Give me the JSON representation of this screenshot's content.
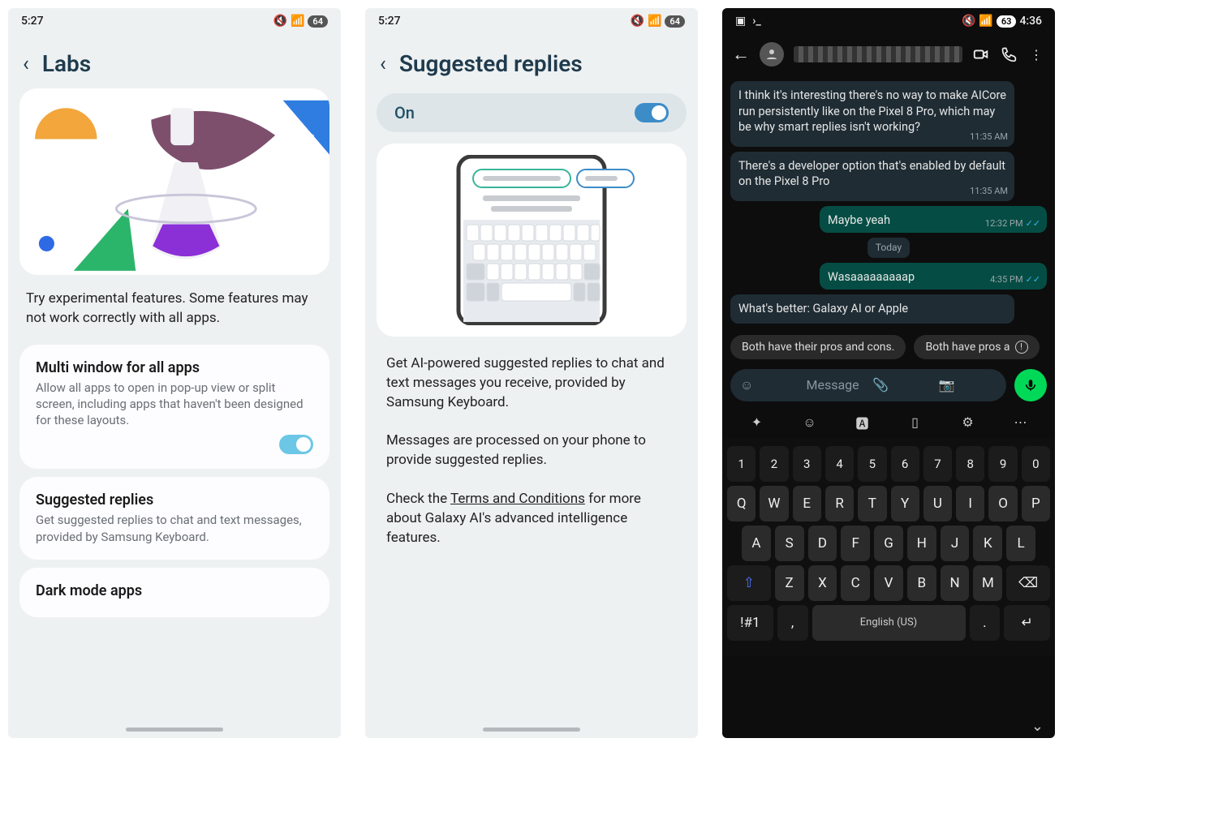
{
  "screen1": {
    "status": {
      "time": "5:27",
      "battery": "64"
    },
    "title": "Labs",
    "desc": "Try experimental features. Some features may not work correctly with all apps.",
    "items": [
      {
        "title": "Multi window for all apps",
        "sub": "Allow all apps to open in pop-up view or split screen, including apps that haven't been designed for these layouts.",
        "toggle": true
      },
      {
        "title": "Suggested replies",
        "sub": "Get suggested replies to chat and text messages, provided by Samsung Keyboard."
      },
      {
        "title": "Dark mode apps"
      }
    ]
  },
  "screen2": {
    "status": {
      "time": "5:27",
      "battery": "64"
    },
    "title": "Suggested replies",
    "on_label": "On",
    "p1": "Get AI-powered suggested replies to chat and text messages you receive, provided by Samsung Keyboard.",
    "p2": "Messages are processed on your phone to provide suggested replies.",
    "p3a": "Check the ",
    "p3link": "Terms and Conditions",
    "p3b": " for more about Galaxy AI's advanced intelligence features."
  },
  "screen3": {
    "status": {
      "time": "4:36",
      "battery": "63"
    },
    "messages": [
      {
        "dir": "in",
        "text": "I think it's interesting there's no way to make AICore run persistently like on the Pixel 8 Pro, which may be why smart replies isn't working?",
        "time": "11:35 AM"
      },
      {
        "dir": "in",
        "text": "There's a developer option that's enabled by default on the Pixel 8 Pro",
        "time": "11:35 AM"
      },
      {
        "dir": "out",
        "text": "Maybe yeah",
        "time": "12:32 PM"
      },
      {
        "dir": "day",
        "text": "Today"
      },
      {
        "dir": "out",
        "text": "Wasaaaaaaaaap",
        "time": "4:35 PM"
      },
      {
        "dir": "in",
        "text": "What's better: Galaxy AI or Apple",
        "time": ""
      }
    ],
    "suggestions": [
      "Both have their pros and cons.",
      "Both have pros a"
    ],
    "input_placeholder": "Message",
    "kb_rows": {
      "nums": [
        "1",
        "2",
        "3",
        "4",
        "5",
        "6",
        "7",
        "8",
        "9",
        "0"
      ],
      "row1": [
        "Q",
        "W",
        "E",
        "R",
        "T",
        "Y",
        "U",
        "I",
        "O",
        "P"
      ],
      "row2": [
        "A",
        "S",
        "D",
        "F",
        "G",
        "H",
        "J",
        "K",
        "L"
      ],
      "row3": [
        "Z",
        "X",
        "C",
        "V",
        "B",
        "N",
        "M"
      ],
      "space_label": "English (US)",
      "sym_label": "!#1"
    }
  }
}
